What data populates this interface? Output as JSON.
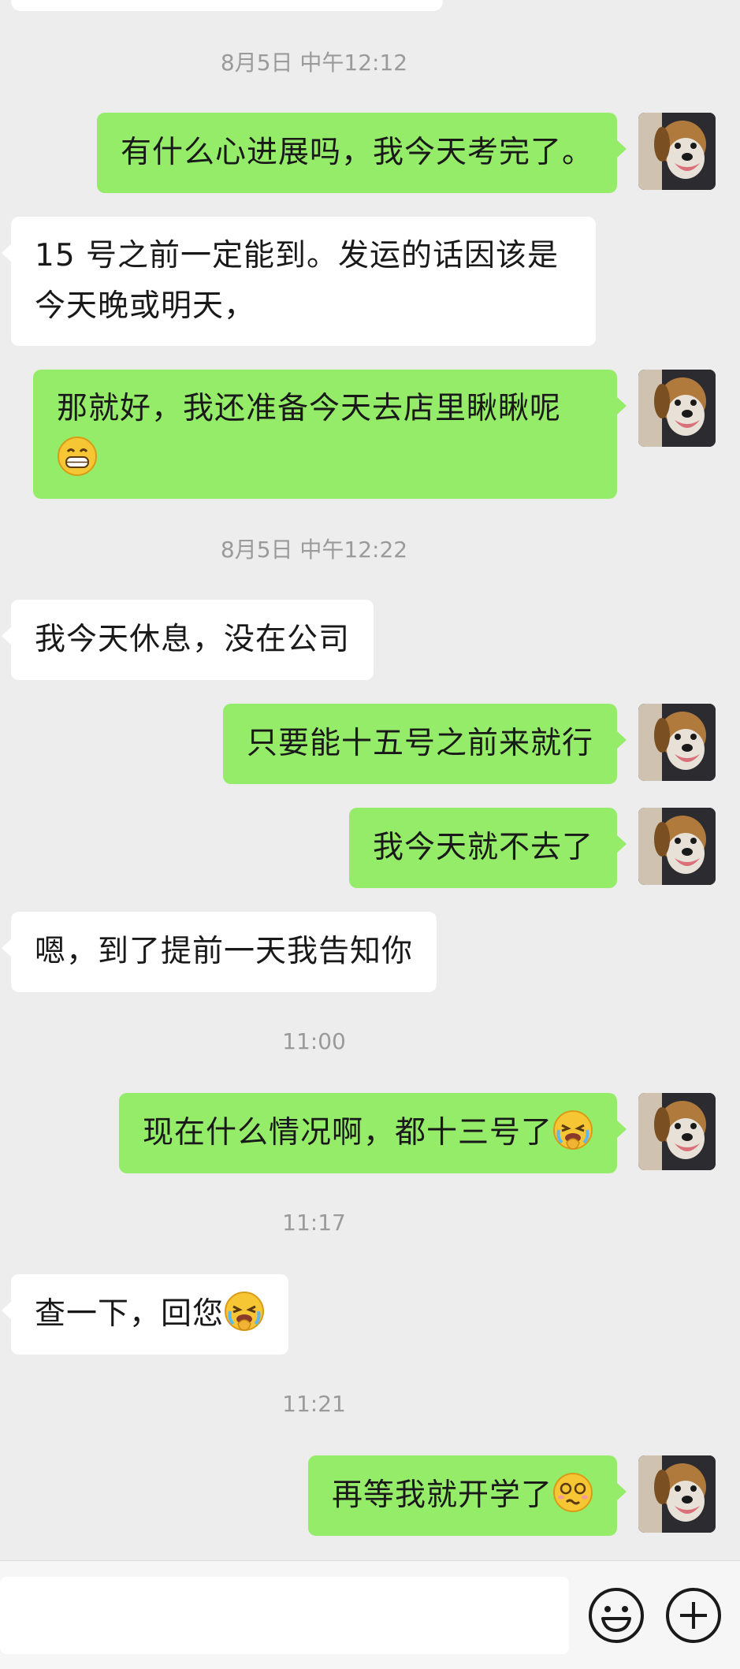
{
  "messages": [
    {
      "type": "timestamp",
      "text": "8月5日 中午12:12"
    },
    {
      "type": "outgoing",
      "text": "有什么心进展吗，我今天考完了。"
    },
    {
      "type": "incoming",
      "line1": "15 号之前一定能到。发运的话因该是",
      "line2": "今天晚或明天，"
    },
    {
      "type": "outgoing",
      "line1": "那就好，我还准备今天去店里瞅瞅呢",
      "emoji": "grinning-face-emoji"
    },
    {
      "type": "timestamp",
      "text": "8月5日 中午12:22"
    },
    {
      "type": "incoming",
      "text": "我今天休息，没在公司"
    },
    {
      "type": "outgoing",
      "text": "只要能十五号之前来就行"
    },
    {
      "type": "outgoing",
      "text": "我今天就不去了"
    },
    {
      "type": "incoming",
      "text": "嗯，到了提前一天我告知你"
    },
    {
      "type": "timestamp",
      "text": "11:00"
    },
    {
      "type": "outgoing",
      "text": "现在什么情况啊，都十三号了",
      "emoji": "face-with-hand-over-mouth-crying-emoji"
    },
    {
      "type": "timestamp",
      "text": "11:17"
    },
    {
      "type": "incoming",
      "text": "查一下，回您",
      "emoji": "face-with-hand-over-mouth-crying-emoji"
    },
    {
      "type": "timestamp",
      "text": "11:21"
    },
    {
      "type": "outgoing",
      "text": "再等我就开学了",
      "emoji": "dizzy-face-emoji"
    }
  ],
  "avatar": {
    "icon": "dog-avatar-icon"
  },
  "input_bar": {
    "emoji_button": "smiley-icon",
    "more_button": "plus-icon"
  },
  "colors": {
    "outgoing_bubble": "#95ec69",
    "incoming_bubble": "#ffffff",
    "background": "#ededed",
    "timestamp": "#9a9a9a"
  }
}
